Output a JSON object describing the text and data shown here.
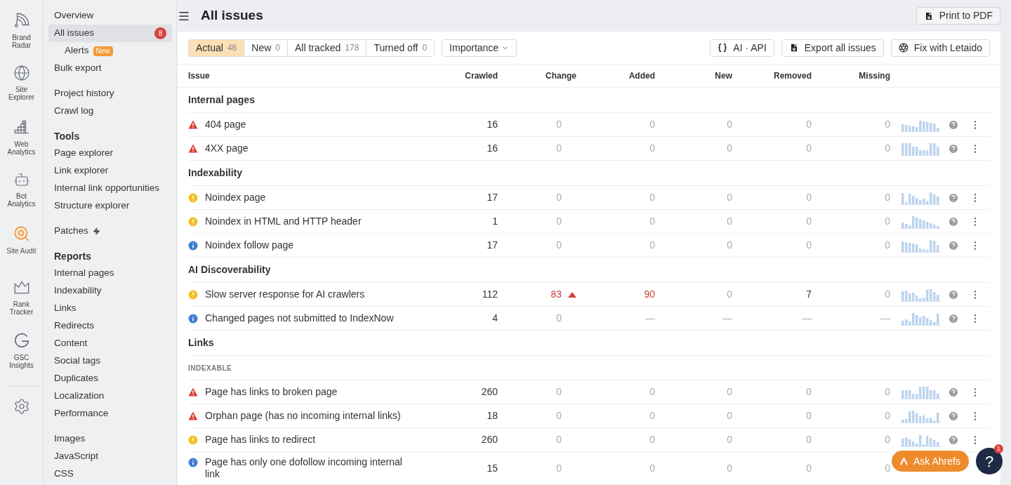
{
  "rail": {
    "items": [
      {
        "label": "Brand Radar",
        "selected": false
      },
      {
        "label": "Site Explorer",
        "selected": false
      },
      {
        "label": "Web Analytics",
        "selected": false
      },
      {
        "label": "Bot Analytics",
        "selected": false
      },
      {
        "label": "Site Audit",
        "selected": true
      },
      {
        "label": "Rank Tracker",
        "selected": false
      },
      {
        "label": "GSC Insights",
        "selected": false
      }
    ]
  },
  "nav": {
    "groups": [
      {
        "items": [
          {
            "label": "Overview",
            "selected": false
          },
          {
            "label": "All issues",
            "selected": true,
            "badge": {
              "text": "8",
              "kind": "count"
            },
            "children": [
              {
                "label": "Alerts",
                "selected": false,
                "badge": {
                  "text": "New",
                  "kind": "new"
                }
              }
            ]
          },
          {
            "label": "Bulk export",
            "selected": false
          }
        ]
      },
      {
        "items": [
          {
            "label": "Project history",
            "selected": false
          },
          {
            "label": "Crawl log",
            "selected": false
          }
        ]
      },
      {
        "heading": "Tools",
        "items": [
          {
            "label": "Page explorer",
            "selected": false
          },
          {
            "label": "Link explorer",
            "selected": false
          },
          {
            "label": "Internal link opportunities",
            "selected": false
          },
          {
            "label": "Structure explorer",
            "selected": false
          }
        ]
      },
      {
        "items": [
          {
            "label": "Patches",
            "selected": false,
            "kind": "premium"
          }
        ]
      },
      {
        "heading": "Reports",
        "items": [
          {
            "label": "Internal pages",
            "selected": false
          },
          {
            "label": "Indexability",
            "selected": false
          },
          {
            "label": "Links",
            "selected": false
          },
          {
            "label": "Redirects",
            "selected": false
          },
          {
            "label": "Content",
            "selected": false
          },
          {
            "label": "Social tags",
            "selected": false
          },
          {
            "label": "Duplicates",
            "selected": false
          },
          {
            "label": "Localization",
            "selected": false
          },
          {
            "label": "Performance",
            "selected": false
          }
        ]
      },
      {
        "items": [
          {
            "label": "Images",
            "selected": false
          },
          {
            "label": "JavaScript",
            "selected": false
          },
          {
            "label": "CSS",
            "selected": false
          }
        ]
      }
    ]
  },
  "header": {
    "title": "All issues",
    "print_button": "Print to PDF"
  },
  "filters": [
    {
      "label": "Actual",
      "count": "46",
      "selected": true
    },
    {
      "label": "New",
      "count": "0",
      "selected": false
    },
    {
      "label": "All tracked",
      "count": "178",
      "selected": false
    },
    {
      "label": "Turned off",
      "count": "0",
      "selected": false
    }
  ],
  "sort_dropdown": "Importance",
  "actions": [
    "AI · API",
    "Export all issues",
    "Fix with Letaido"
  ],
  "table": {
    "columns": [
      "Issue",
      "Crawled",
      "Change",
      "Added",
      "New",
      "Removed",
      "Missing"
    ],
    "rows": [
      {
        "kind": "group",
        "label": "Internal pages"
      },
      {
        "kind": "error",
        "label": "404 page",
        "tools": true,
        "cells": [
          {
            "text": "16",
            "kind": "normal"
          },
          {
            "text": "0",
            "kind": "muted"
          },
          {
            "text": "0",
            "kind": "muted"
          },
          {
            "text": "0",
            "kind": "muted"
          },
          {
            "text": "0",
            "kind": "muted"
          },
          {
            "text": "0",
            "kind": "muted"
          }
        ]
      },
      {
        "kind": "error",
        "label": "4XX page",
        "tools": true,
        "cells": [
          {
            "text": "16",
            "kind": "normal"
          },
          {
            "text": "0",
            "kind": "muted"
          },
          {
            "text": "0",
            "kind": "muted"
          },
          {
            "text": "0",
            "kind": "muted"
          },
          {
            "text": "0",
            "kind": "muted"
          },
          {
            "text": "0",
            "kind": "muted"
          }
        ]
      },
      {
        "kind": "group",
        "label": "Indexability"
      },
      {
        "kind": "warning",
        "label": "Noindex page",
        "tools": true,
        "cells": [
          {
            "text": "17",
            "kind": "normal"
          },
          {
            "text": "0",
            "kind": "muted"
          },
          {
            "text": "0",
            "kind": "muted"
          },
          {
            "text": "0",
            "kind": "muted"
          },
          {
            "text": "0",
            "kind": "muted"
          },
          {
            "text": "0",
            "kind": "muted"
          }
        ]
      },
      {
        "kind": "warning",
        "label": "Noindex in HTML and HTTP header",
        "tools": true,
        "cells": [
          {
            "text": "1",
            "kind": "normal"
          },
          {
            "text": "0",
            "kind": "muted"
          },
          {
            "text": "0",
            "kind": "muted"
          },
          {
            "text": "0",
            "kind": "muted"
          },
          {
            "text": "0",
            "kind": "muted"
          },
          {
            "text": "0",
            "kind": "muted"
          }
        ]
      },
      {
        "kind": "notice",
        "label": "Noindex follow page",
        "tools": true,
        "cells": [
          {
            "text": "17",
            "kind": "normal"
          },
          {
            "text": "0",
            "kind": "muted"
          },
          {
            "text": "0",
            "kind": "muted"
          },
          {
            "text": "0",
            "kind": "muted"
          },
          {
            "text": "0",
            "kind": "muted"
          },
          {
            "text": "0",
            "kind": "muted"
          }
        ]
      },
      {
        "kind": "group",
        "label": "AI Discoverability"
      },
      {
        "kind": "warning",
        "label": "Slow server response for AI crawlers",
        "tools": true,
        "cells": [
          {
            "text": "112",
            "kind": "normal"
          },
          {
            "text": "83",
            "kind": "rising"
          },
          {
            "text": "90",
            "kind": "alert"
          },
          {
            "text": "0",
            "kind": "muted"
          },
          {
            "text": "7",
            "kind": "normal"
          },
          {
            "text": "0",
            "kind": "muted"
          }
        ]
      },
      {
        "kind": "notice",
        "label": "Changed pages not submitted to IndexNow",
        "tools": true,
        "cells": [
          {
            "text": "4",
            "kind": "normal"
          },
          {
            "text": "0",
            "kind": "muted"
          },
          {
            "text": "—",
            "kind": "muted"
          },
          {
            "text": "—",
            "kind": "muted"
          },
          {
            "text": "—",
            "kind": "muted"
          },
          {
            "text": "—",
            "kind": "muted"
          }
        ]
      },
      {
        "kind": "group",
        "label": "Links"
      },
      {
        "kind": "subgroup",
        "label": "INDEXABLE"
      },
      {
        "kind": "error",
        "label": "Page has links to broken page",
        "tools": true,
        "cells": [
          {
            "text": "260",
            "kind": "normal"
          },
          {
            "text": "0",
            "kind": "muted"
          },
          {
            "text": "0",
            "kind": "muted"
          },
          {
            "text": "0",
            "kind": "muted"
          },
          {
            "text": "0",
            "kind": "muted"
          },
          {
            "text": "0",
            "kind": "muted"
          }
        ]
      },
      {
        "kind": "error",
        "label": "Orphan page (has no incoming internal links)",
        "tools": true,
        "cells": [
          {
            "text": "18",
            "kind": "normal"
          },
          {
            "text": "0",
            "kind": "muted"
          },
          {
            "text": "0",
            "kind": "muted"
          },
          {
            "text": "0",
            "kind": "muted"
          },
          {
            "text": "0",
            "kind": "muted"
          },
          {
            "text": "0",
            "kind": "muted"
          }
        ]
      },
      {
        "kind": "warning",
        "label": "Page has links to redirect",
        "tools": true,
        "cells": [
          {
            "text": "260",
            "kind": "normal"
          },
          {
            "text": "0",
            "kind": "muted"
          },
          {
            "text": "0",
            "kind": "muted"
          },
          {
            "text": "0",
            "kind": "muted"
          },
          {
            "text": "0",
            "kind": "muted"
          },
          {
            "text": "0",
            "kind": "muted"
          }
        ]
      },
      {
        "kind": "notice",
        "label": "Page has only one dofollow incoming internal link",
        "tools": false,
        "cells": [
          {
            "text": "15",
            "kind": "normal"
          },
          {
            "text": "0",
            "kind": "muted"
          },
          {
            "text": "0",
            "kind": "muted"
          },
          {
            "text": "0",
            "kind": "muted"
          },
          {
            "text": "0",
            "kind": "muted"
          },
          {
            "text": "0",
            "kind": "muted"
          }
        ]
      }
    ]
  },
  "assistant_button": "Ask Ahrefs",
  "help_button": {
    "label": "?",
    "badge": "1"
  }
}
